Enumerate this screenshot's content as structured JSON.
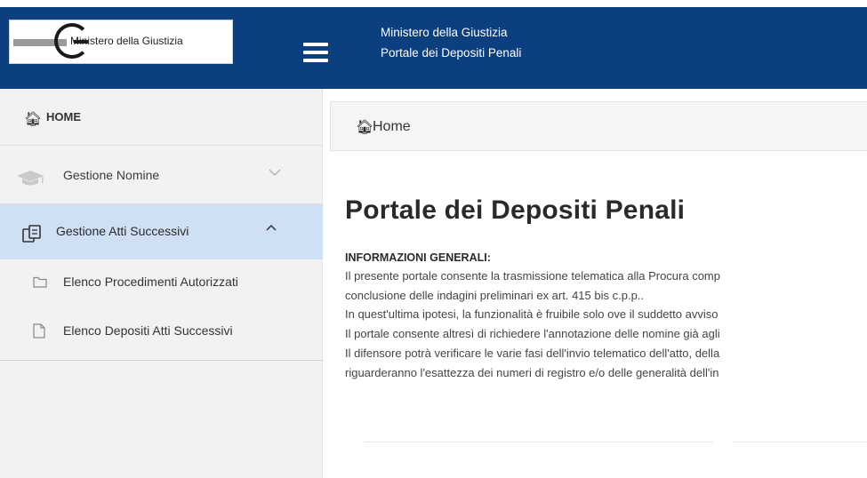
{
  "header": {
    "logo_text": "Ministero della Giustizia",
    "title_line1": "Ministero della Giustizia",
    "title_line2": "Portale dei Depositi Penali"
  },
  "sidebar": {
    "items": [
      {
        "label": "HOME",
        "icon": "home-icon"
      },
      {
        "label": "Gestione Nomine",
        "icon": "graduation-cap-icon",
        "chevron": "chevron-down-icon"
      },
      {
        "label": "Gestione Atti Successivi",
        "icon": "documents-icon",
        "chevron": "chevron-up-icon"
      }
    ],
    "subitems": [
      {
        "label": "Elenco Procedimenti Autorizzati",
        "icon": "folder-icon"
      },
      {
        "label": "Elenco Depositi Atti Successivi",
        "icon": "file-icon"
      }
    ]
  },
  "breadcrumb": {
    "label": "Home",
    "icon": "home-icon"
  },
  "main": {
    "title": "Portale dei Depositi Penali",
    "section_title": "INFORMAZIONI GENERALI:",
    "paragraphs": [
      "Il presente portale consente la trasmissione telematica alla Procura comp",
      "conclusione delle indagini preliminari ex art. 415 bis c.p.p..",
      "In quest'ultima ipotesi, la funzionalità è fruibile solo ove il suddetto avviso",
      "Il portale consente altresì di richiedere l'annotazione delle nomine già agli",
      "Il difensore potrà verificare le varie fasi dell'invio telematico dell'atto, della",
      "riguarderanno l'esattezza dei numeri di registro e/o delle generalità dell'in"
    ]
  },
  "colors": {
    "header_bg": "#0b3f80",
    "sidebar_bg": "#f2f2f2",
    "active_item_bg": "#cfe0f5"
  }
}
